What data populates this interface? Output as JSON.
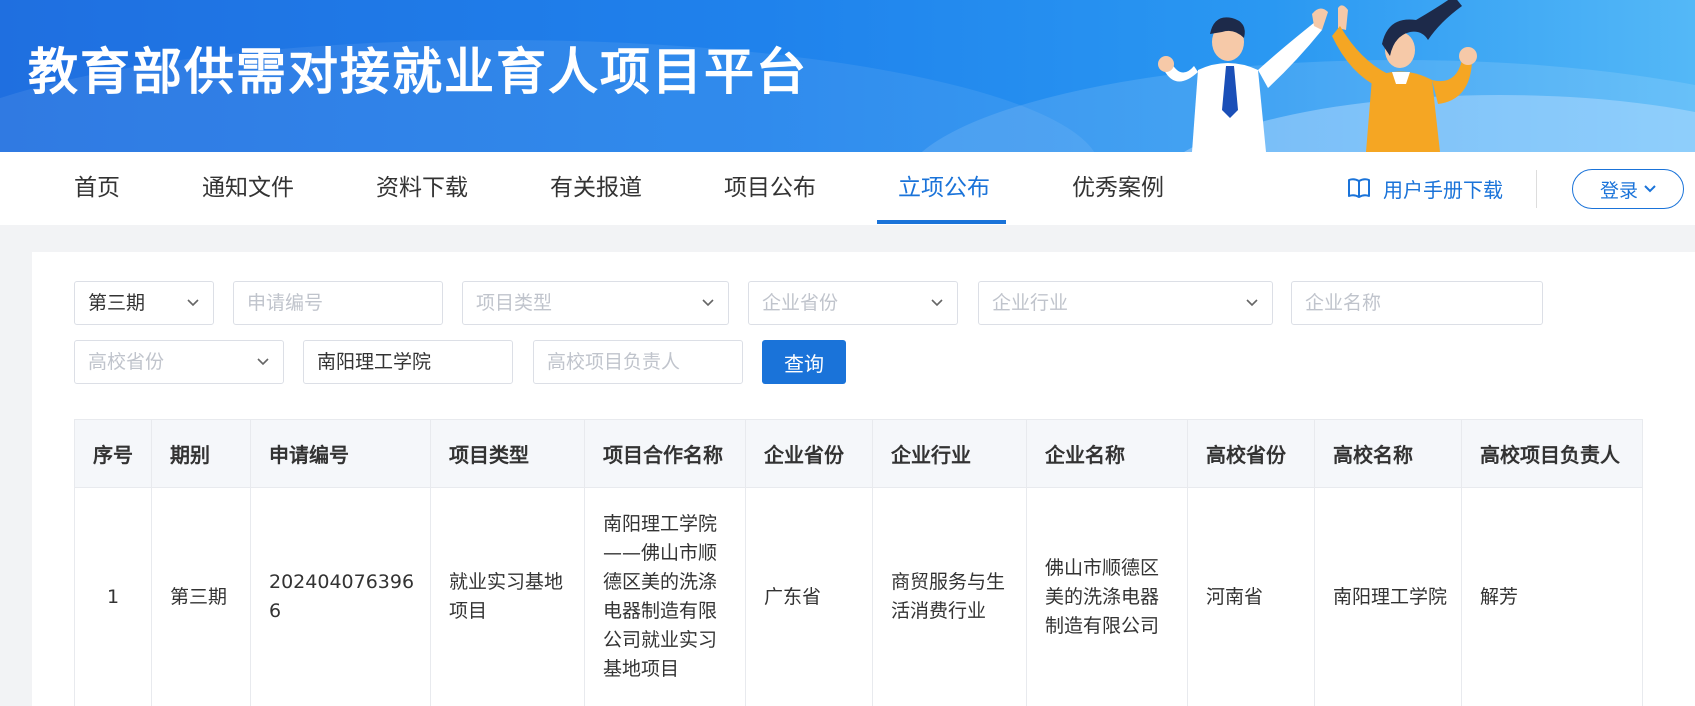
{
  "banner": {
    "title": "教育部供需对接就业育人项目平台"
  },
  "nav": {
    "items": [
      "首页",
      "通知文件",
      "资料下载",
      "有关报道",
      "项目公布",
      "立项公布",
      "优秀案例"
    ],
    "active": "立项公布",
    "manual_label": "用户手册下载",
    "login_label": "登录"
  },
  "filters": {
    "period": {
      "value": "第三期"
    },
    "application_no": {
      "placeholder": "申请编号"
    },
    "project_type": {
      "placeholder": "项目类型"
    },
    "enterprise_province": {
      "placeholder": "企业省份"
    },
    "enterprise_industry": {
      "placeholder": "企业行业"
    },
    "enterprise_name": {
      "placeholder": "企业名称"
    },
    "university_province": {
      "placeholder": "高校省份"
    },
    "university_name": {
      "value": "南阳理工学院"
    },
    "university_leader": {
      "placeholder": "高校项目负责人"
    },
    "query_label": "查询"
  },
  "table": {
    "headers": [
      "序号",
      "期别",
      "申请编号",
      "项目类型",
      "项目合作名称",
      "企业省份",
      "企业行业",
      "企业名称",
      "高校省份",
      "高校名称",
      "高校项目负责人"
    ],
    "rows": [
      [
        "1",
        "第三期",
        "2024040763966",
        "就业实习基地项目",
        "南阳理工学院——佛山市顺德区美的洗涤电器制造有限公司就业实习基地项目",
        "广东省",
        "商贸服务与生活消费行业",
        "佛山市顺德区美的洗涤电器制造有限公司",
        "河南省",
        "南阳理工学院",
        "解芳"
      ]
    ]
  },
  "colors": {
    "accent": "#1a73d9",
    "banner_start": "#1f6fe0",
    "banner_end": "#54b8f7"
  }
}
